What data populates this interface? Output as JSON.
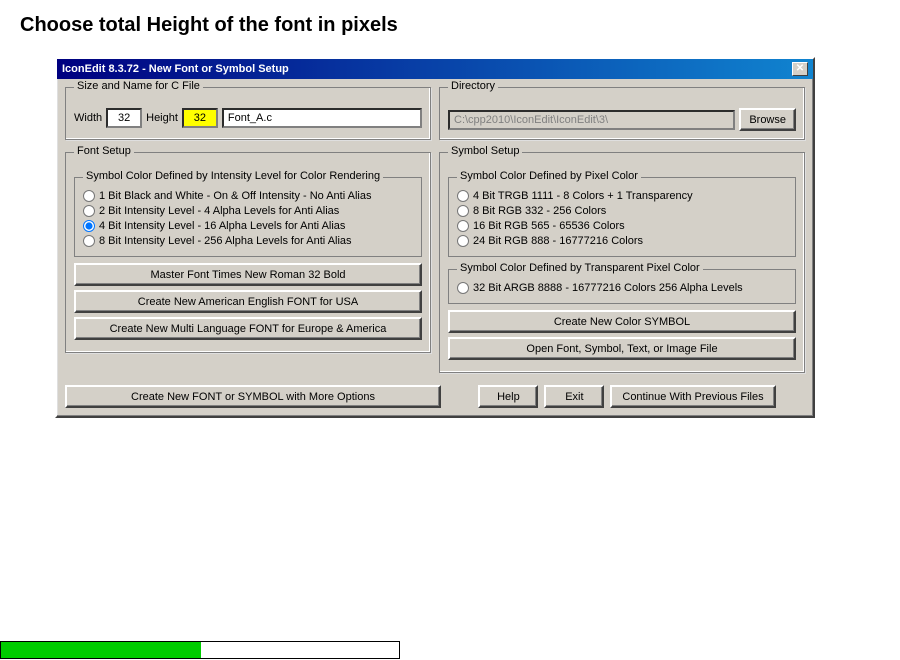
{
  "page": {
    "title": "Choose total Height of the font in pixels"
  },
  "dialog": {
    "title": "IconEdit 8.3.72 - New Font or Symbol Setup",
    "close_label": "✕"
  },
  "size_name_section": {
    "group_title": "Size and Name for C File",
    "width_label": "Width",
    "width_value": "32",
    "height_label": "Height",
    "height_value": "32",
    "filename_value": "Font_A.c"
  },
  "directory_section": {
    "group_title": "Directory",
    "path_value": "C:\\cpp2010\\IconEdit\\IconEdit\\3\\",
    "browse_label": "Browse"
  },
  "font_setup": {
    "group_title": "Font Setup",
    "intensity_group_title": "Symbol Color Defined by Intensity Level for Color Rendering",
    "options": [
      {
        "label": "1 Bit Black and White - On & Off Intensity - No Anti Alias",
        "checked": false
      },
      {
        "label": "2 Bit Intensity Level - 4 Alpha Levels for Anti Alias",
        "checked": false
      },
      {
        "label": "4 Bit Intensity Level - 16 Alpha Levels for Anti Alias",
        "checked": true
      },
      {
        "label": "8 Bit Intensity Level - 256 Alpha Levels for Anti Alias",
        "checked": false
      }
    ],
    "btn_master": "Master Font  Times New Roman 32 Bold",
    "btn_english": "Create New American English FONT for USA",
    "btn_multilang": "Create New Multi Language FONT for Europe & America"
  },
  "symbol_setup": {
    "group_title": "Symbol Setup",
    "pixel_color_group_title": "Symbol Color Defined by Pixel Color",
    "pixel_options": [
      {
        "label": "4 Bit TRGB 1111 - 8 Colors + 1 Transparency",
        "checked": false
      },
      {
        "label": "8 Bit RGB 332 - 256 Colors",
        "checked": false
      },
      {
        "label": "16 Bit RGB 565 - 65536 Colors",
        "checked": false
      },
      {
        "label": "24 Bit RGB 888 - 16777216 Colors",
        "checked": false
      }
    ],
    "transparent_group_title": "Symbol Color Defined by Transparent Pixel Color",
    "transparent_options": [
      {
        "label": "32 Bit ARGB 8888 - 16777216 Colors 256 Alpha Levels",
        "checked": false
      }
    ],
    "btn_color_symbol": "Create New Color SYMBOL",
    "btn_open": "Open Font, Symbol, Text, or Image File"
  },
  "bottom_buttons": {
    "btn_new_font_symbol": "Create New FONT or SYMBOL with More Options",
    "btn_help": "Help",
    "btn_exit": "Exit",
    "btn_continue": "Continue With Previous Files"
  }
}
